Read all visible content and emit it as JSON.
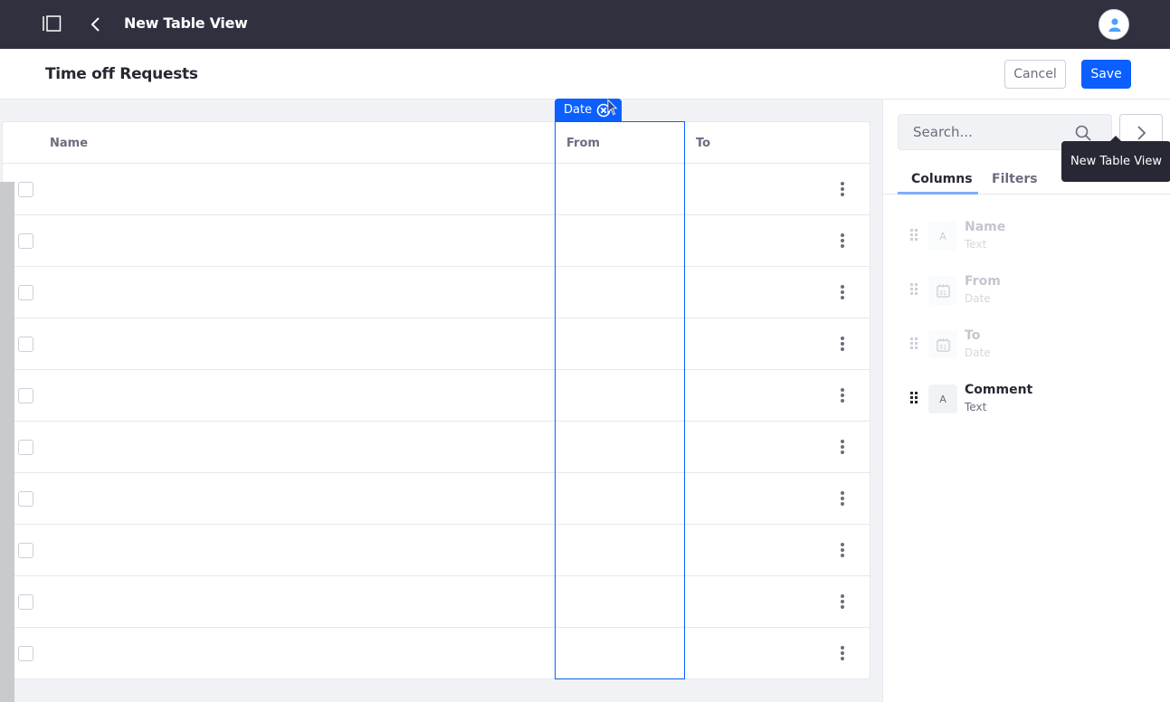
{
  "topbar": {
    "title": "New Table View",
    "icons": {
      "panel": "sidebar-toggle-icon",
      "back": "chevron-left-icon",
      "avatar": "user-icon"
    }
  },
  "header": {
    "page_title": "Time off Requests",
    "cancel_label": "Cancel",
    "save_label": "Save"
  },
  "colors": {
    "accent": "#0b5fff",
    "topbar_bg": "#30313f",
    "page_bg": "#f1f2f5"
  },
  "table": {
    "group_tab": {
      "label": "Date",
      "close_icon": "times-circle-icon"
    },
    "columns": [
      {
        "label": "Name"
      },
      {
        "label": "From"
      },
      {
        "label": "To"
      }
    ],
    "row_count": 10
  },
  "sidebar": {
    "search_placeholder": "Search...",
    "tooltip": "New Table View",
    "tabs": [
      {
        "label": "Columns",
        "active": true
      },
      {
        "label": "Filters",
        "active": false
      }
    ],
    "fields": [
      {
        "name": "Name",
        "type": "Text",
        "icon": "A",
        "enabled": false
      },
      {
        "name": "From",
        "type": "Date",
        "icon": "calendar-icon",
        "enabled": false
      },
      {
        "name": "To",
        "type": "Date",
        "icon": "calendar-icon",
        "enabled": false
      },
      {
        "name": "Comment",
        "type": "Text",
        "icon": "A",
        "enabled": true
      }
    ]
  }
}
